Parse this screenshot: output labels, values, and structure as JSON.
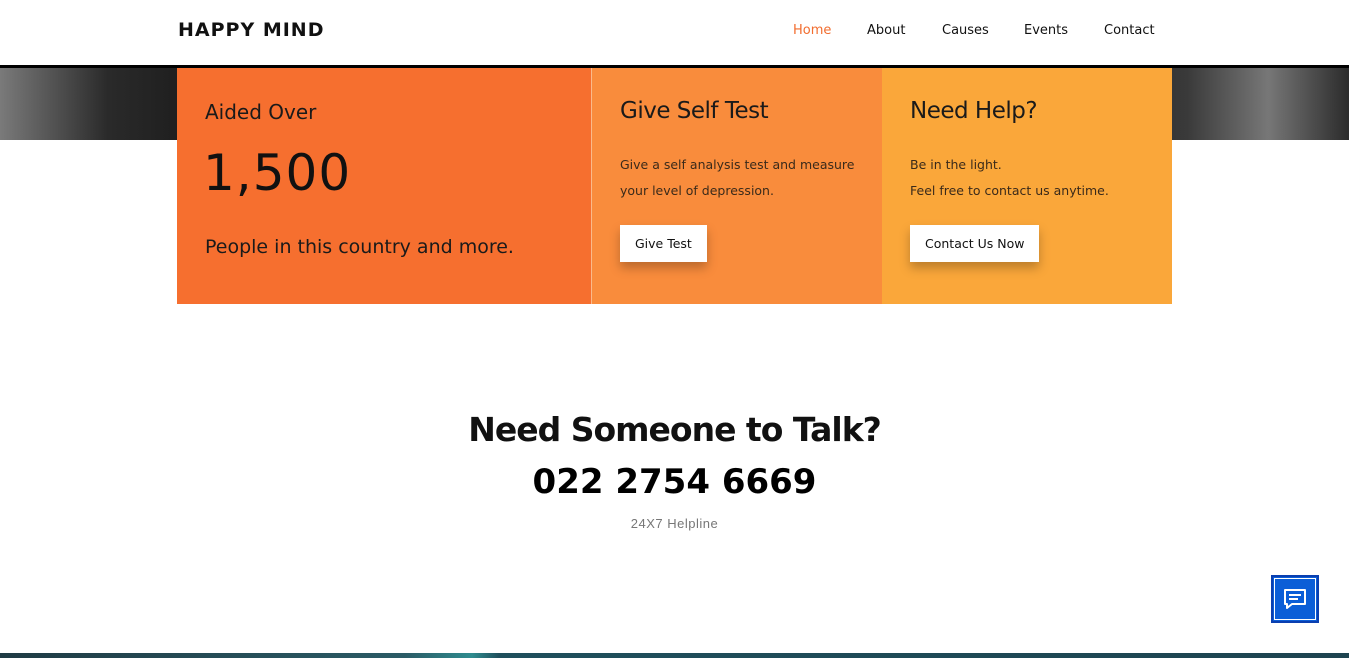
{
  "brand": "HAPPY MIND",
  "nav": {
    "items": [
      {
        "label": "Home",
        "active": true
      },
      {
        "label": "About"
      },
      {
        "label": "Causes"
      },
      {
        "label": "Events"
      },
      {
        "label": "Contact"
      }
    ]
  },
  "cards": {
    "aided": {
      "kicker": "Aided Over",
      "number": "1,500",
      "sub": "People in this country and more."
    },
    "self_test": {
      "title": "Give Self Test",
      "text": "Give a self analysis test and measure your level of depression.",
      "button": "Give Test"
    },
    "help": {
      "title": "Need Help?",
      "line1": "Be in the light.",
      "line2": "Feel free to contact us anytime.",
      "button": "Contact Us Now"
    }
  },
  "talk": {
    "title": "Need Someone to Talk?",
    "phone": "022 2754 6669",
    "helpline": "24X7 Helpline"
  },
  "colors": {
    "accent": "#f26d2f",
    "card1": "#f66f2f",
    "card2": "#f98c3c",
    "card3": "#faa73a",
    "chat": "#0b5ed7"
  },
  "chat_button": {
    "icon": "chat-icon"
  }
}
